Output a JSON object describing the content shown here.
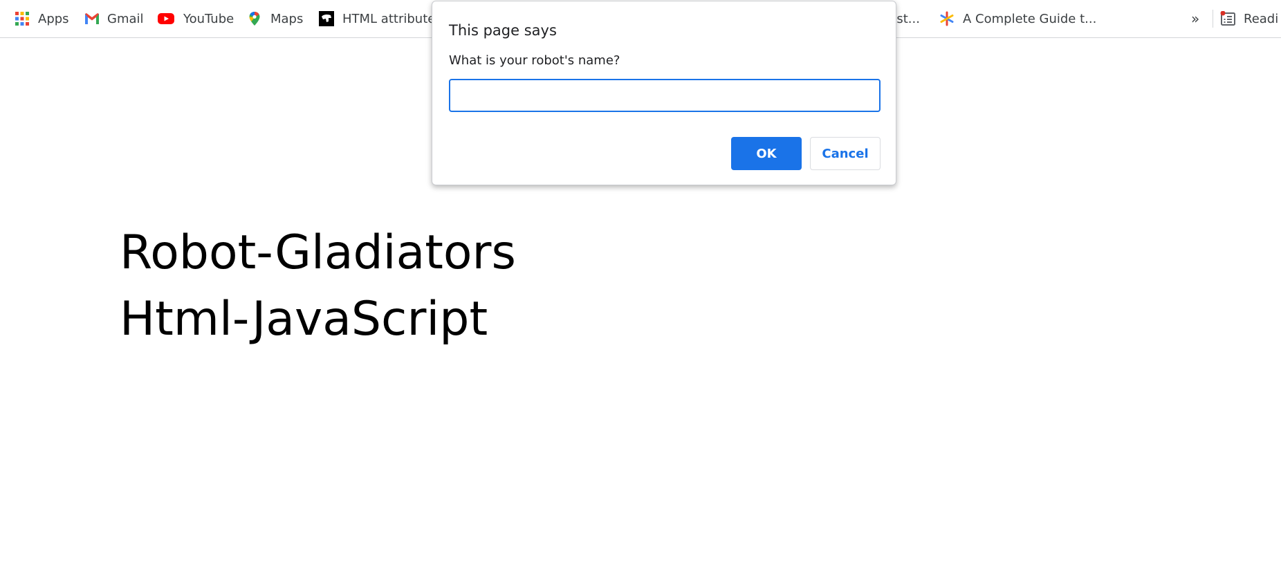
{
  "bookmarks": {
    "apps": "Apps",
    "gmail": "Gmail",
    "youtube": "YouTube",
    "maps": "Maps",
    "html_attribute": "HTML attribute",
    "est": "Est...",
    "complete_guide": "A Complete Guide t...",
    "more": "»",
    "reading": "Readi"
  },
  "colors": {
    "accent": "#1a73e8",
    "youtube_red": "#ff0000",
    "text": "#3c4043"
  },
  "page": {
    "heading_line1": "Robot-Gladiators",
    "heading_line2": "Html-JavaScript"
  },
  "dialog": {
    "title": "This page says",
    "message": "What is your robot's name?",
    "input_value": "",
    "ok_label": "OK",
    "cancel_label": "Cancel"
  }
}
